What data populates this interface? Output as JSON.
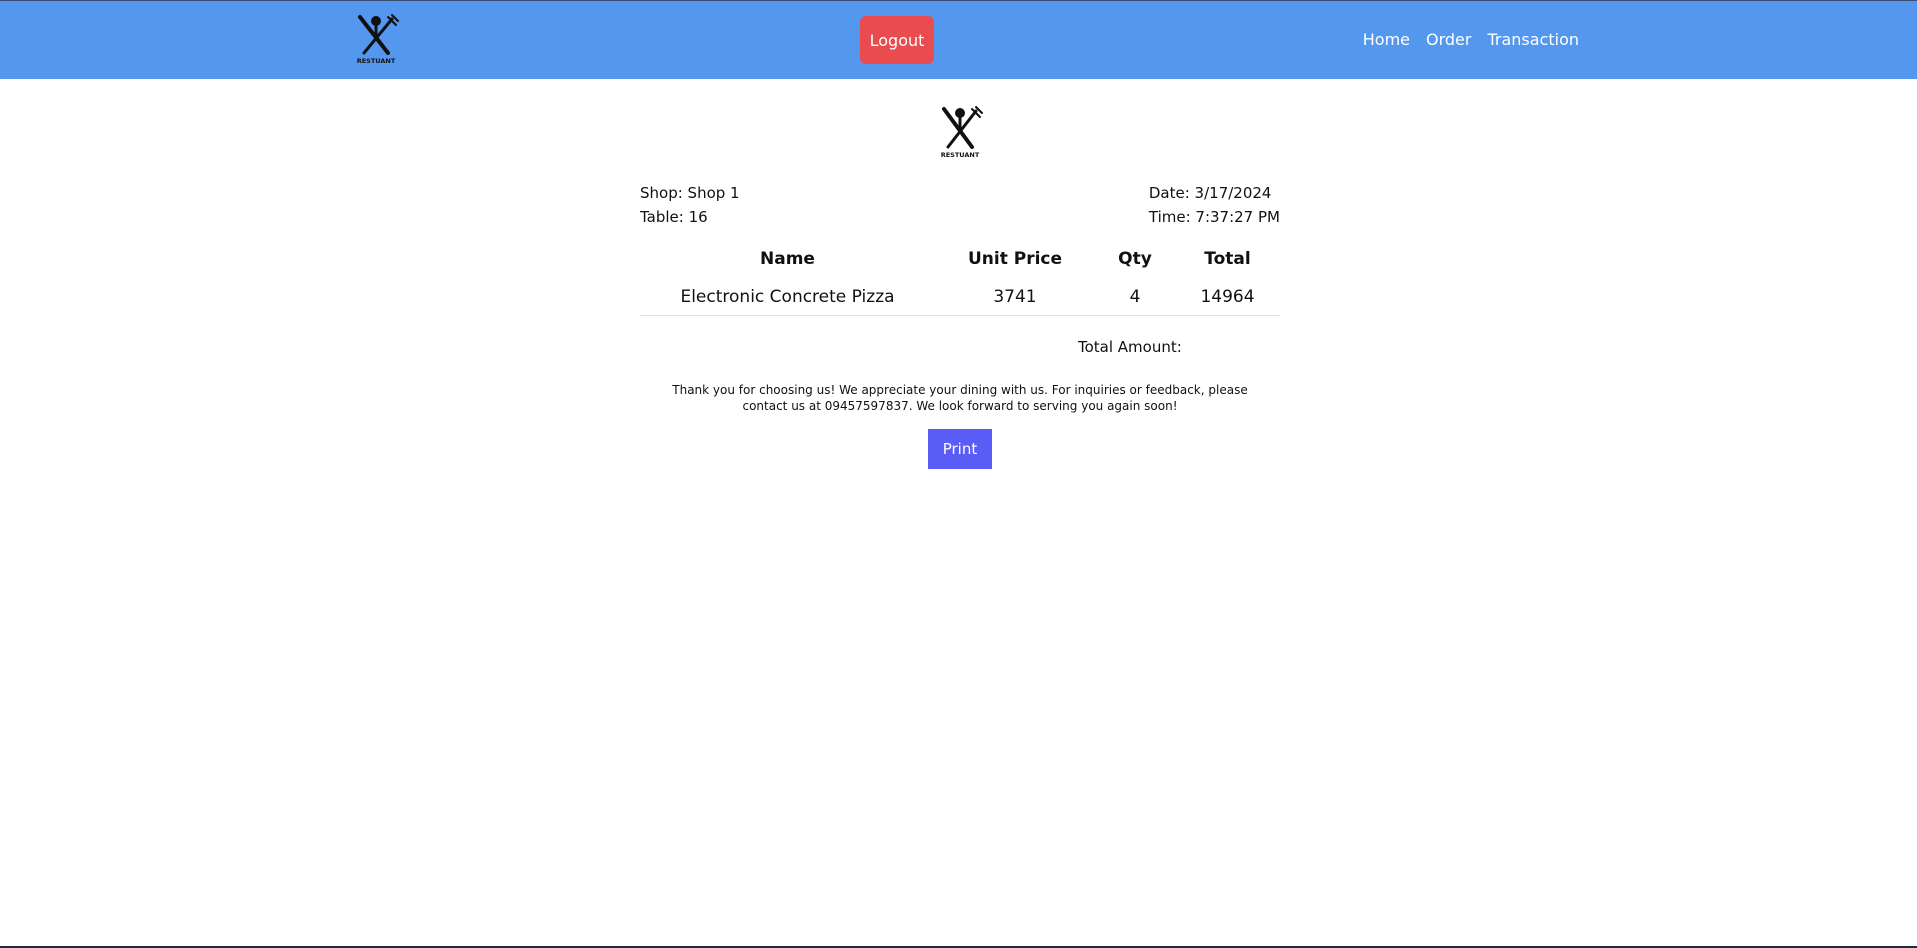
{
  "navbar": {
    "logo_icon": "restaurant-logo-icon",
    "logo_text": "RESTUANT",
    "logout_label": "Logout",
    "links": [
      "Home",
      "Order",
      "Transaction"
    ],
    "colors": {
      "background": "#5497ee",
      "logout": "#e94b4f"
    }
  },
  "receipt": {
    "logo_icon": "restaurant-logo-icon",
    "logo_text": "RESTUANT",
    "shop": "Shop: Shop 1",
    "table": "Table: 16",
    "date": "Date: 3/17/2024",
    "time": "Time: 7:37:27 PM",
    "columns": [
      "Name",
      "Unit Price",
      "Qty",
      "Total"
    ],
    "rows": [
      {
        "name": "Electronic Concrete Pizza",
        "unit_price": "3741",
        "qty": "4",
        "total": "14964"
      }
    ],
    "total_amount_label": "Total Amount:",
    "thanks_text": "Thank you for choosing us! We appreciate your dining with us. For inquiries or feedback, please contact us at 09457597837. We look forward to serving you again soon!",
    "print_label": "Print",
    "colors": {
      "print": "#5a5cf6"
    }
  }
}
